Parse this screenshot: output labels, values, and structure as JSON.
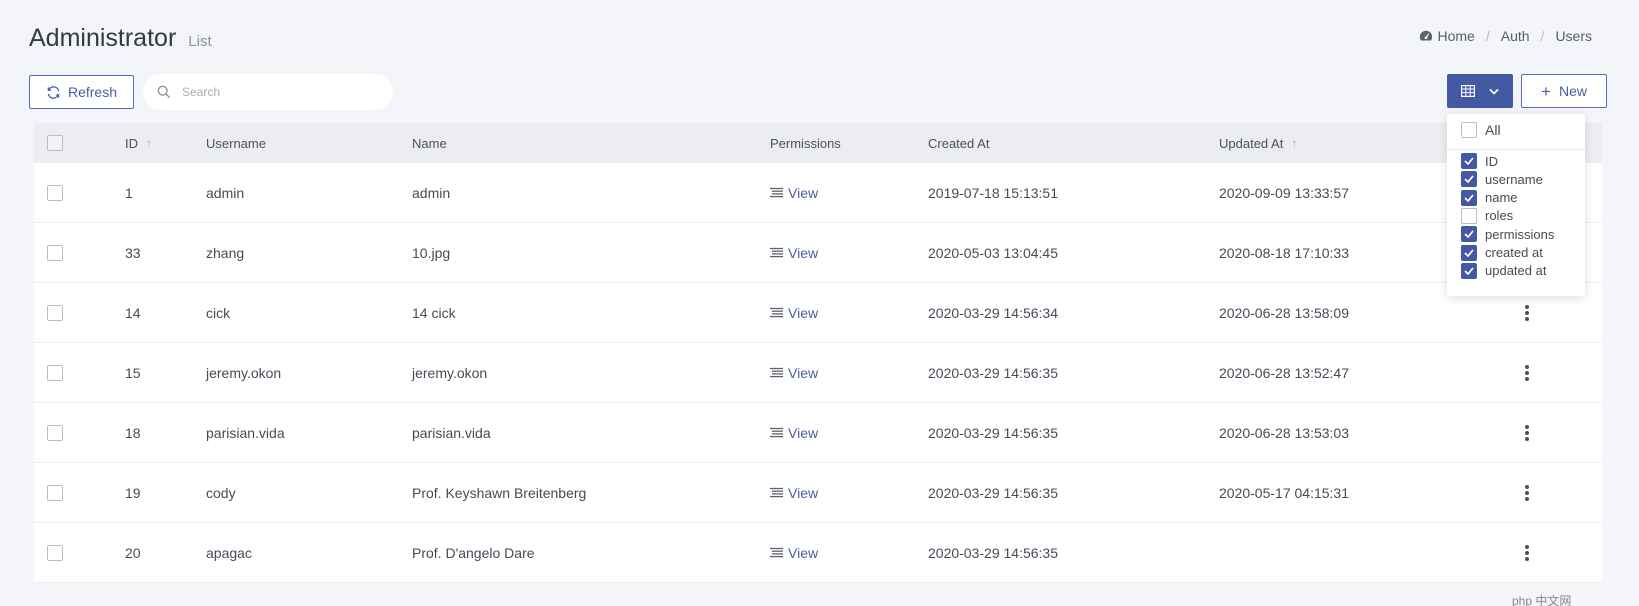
{
  "header": {
    "title": "Administrator",
    "subtitle": "List",
    "breadcrumb": [
      "Home",
      "Auth",
      "Users"
    ]
  },
  "toolbar": {
    "refresh_label": "Refresh",
    "search_placeholder": "Search",
    "new_label": "New"
  },
  "table": {
    "columns": {
      "id": "ID",
      "username": "Username",
      "name": "Name",
      "permissions": "Permissions",
      "created_at": "Created At",
      "updated_at": "Updated At"
    },
    "rows": [
      {
        "id": "1",
        "username": "admin",
        "name": "admin",
        "permissions": "View",
        "created_at": "2019-07-18 15:13:51",
        "updated_at": "2020-09-09 13:33:57"
      },
      {
        "id": "33",
        "username": "zhang",
        "name": "10.jpg",
        "permissions": "View",
        "created_at": "2020-05-03 13:04:45",
        "updated_at": "2020-08-18 17:10:33"
      },
      {
        "id": "14",
        "username": "cick",
        "name": "14 cick",
        "permissions": "View",
        "created_at": "2020-03-29 14:56:34",
        "updated_at": "2020-06-28 13:58:09"
      },
      {
        "id": "15",
        "username": "jeremy.okon",
        "name": "jeremy.okon",
        "permissions": "View",
        "created_at": "2020-03-29 14:56:35",
        "updated_at": "2020-06-28 13:52:47"
      },
      {
        "id": "18",
        "username": "parisian.vida",
        "name": "parisian.vida",
        "permissions": "View",
        "created_at": "2020-03-29 14:56:35",
        "updated_at": "2020-06-28 13:53:03"
      },
      {
        "id": "19",
        "username": "cody",
        "name": "Prof. Keyshawn Breitenberg",
        "permissions": "View",
        "created_at": "2020-03-29 14:56:35",
        "updated_at": "2020-05-17 04:15:31"
      },
      {
        "id": "20",
        "username": "apagac",
        "name": "Prof. D'angelo Dare",
        "permissions": "View",
        "created_at": "2020-03-29 14:56:35",
        "updated_at": ""
      }
    ]
  },
  "column_selector": {
    "all_label": "All",
    "all_checked": false,
    "items": [
      {
        "label": "ID",
        "checked": true
      },
      {
        "label": "username",
        "checked": true
      },
      {
        "label": "name",
        "checked": true
      },
      {
        "label": "roles",
        "checked": false
      },
      {
        "label": "permissions",
        "checked": true
      },
      {
        "label": "created at",
        "checked": true
      },
      {
        "label": "updated at",
        "checked": true
      }
    ]
  },
  "watermark": "php 中文网",
  "colors": {
    "primary": "#4558a3",
    "link": "#4c5ca3",
    "background": "#f4f5f8",
    "header_row": "#ebedf1"
  }
}
